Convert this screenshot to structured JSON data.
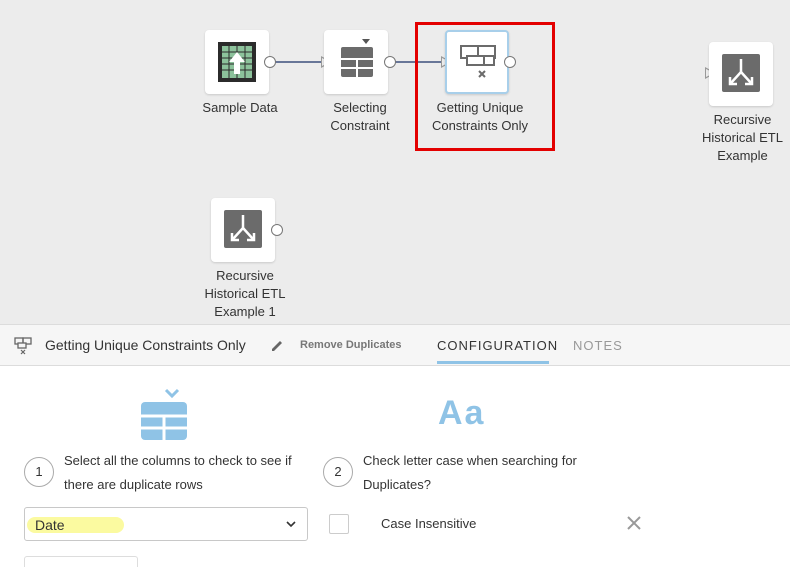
{
  "canvas": {
    "nodes": [
      {
        "id": "sample-data",
        "label": [
          "Sample Data"
        ]
      },
      {
        "id": "selecting-constraint",
        "label": [
          "Selecting",
          "Constraint"
        ]
      },
      {
        "id": "getting-unique",
        "label": [
          "Getting Unique",
          "Constraints Only"
        ]
      },
      {
        "id": "recursive-etl",
        "label": [
          "Recursive",
          "Historical ETL",
          "Example"
        ]
      },
      {
        "id": "recursive-etl-1",
        "label": [
          "Recursive",
          "Historical ETL",
          "Example 1"
        ]
      }
    ]
  },
  "panel": {
    "title": "Getting Unique Constraints Only",
    "subtitle": "Remove Duplicates",
    "tabs": [
      "CONFIGURATION",
      "NOTES"
    ],
    "active_tab": "CONFIGURATION",
    "step1": {
      "number": "1",
      "text_line1": "Select all the columns to check to see if",
      "text_line2": "there are duplicate rows"
    },
    "step2": {
      "number": "2",
      "text_line1": "Check letter case when searching for",
      "text_line2": "Duplicates?"
    },
    "case_icon_text": "Aa",
    "column_select": {
      "value": "Date"
    },
    "checkbox": {
      "label": "Case Insensitive",
      "checked": false
    }
  },
  "colors": {
    "accent": "#8fc3e6",
    "highlight": "#e30000",
    "connector": "#3d4f7c",
    "icon_gray": "#6b6b6b"
  }
}
